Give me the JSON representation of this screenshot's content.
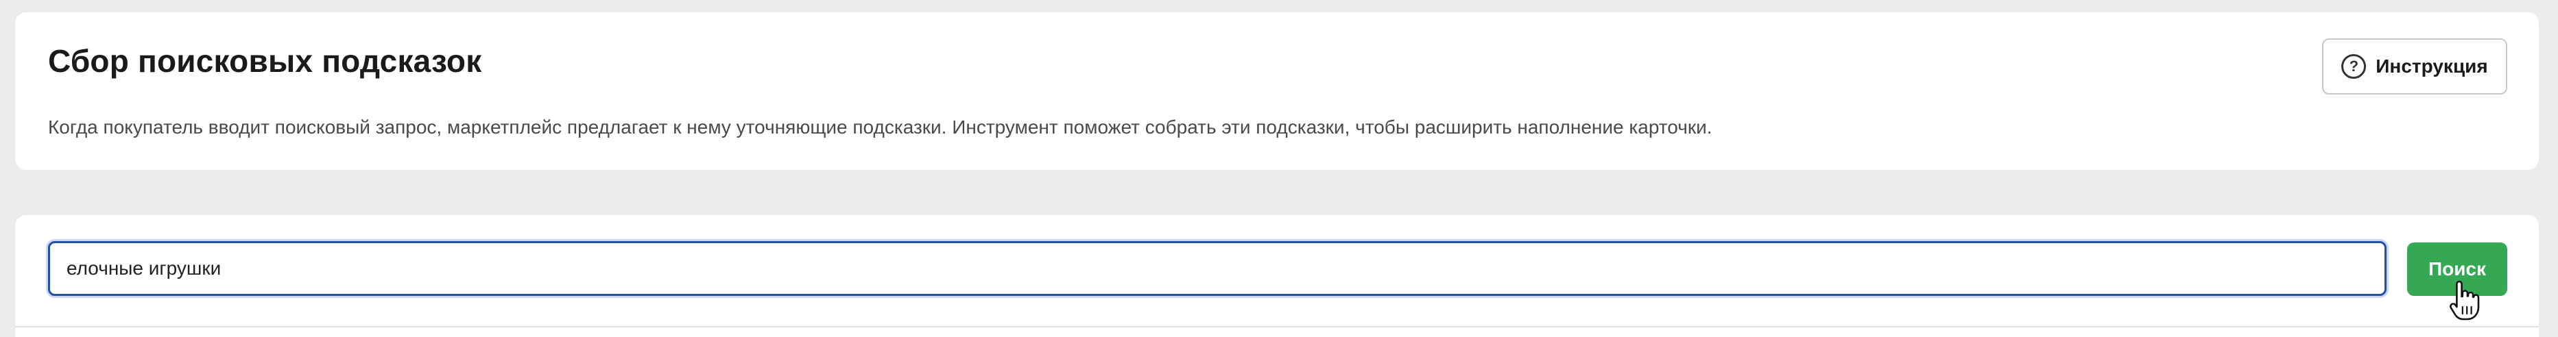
{
  "header": {
    "title": "Сбор поисковых подсказок",
    "description": "Когда покупатель вводит поисковый запрос, маркетплейс предлагает к нему уточняющие подсказки. Инструмент поможет собрать эти подсказки, чтобы расширить наполнение карточки.",
    "instruction_button": {
      "label": "Инструкция",
      "icon": "help-circle-icon"
    }
  },
  "search": {
    "input_value": "елочные игрушки",
    "button_label": "Поиск",
    "button_color": "#34a853",
    "focus_color": "#1f4fa3"
  },
  "cursor": {
    "icon": "hand-pointer-icon"
  }
}
